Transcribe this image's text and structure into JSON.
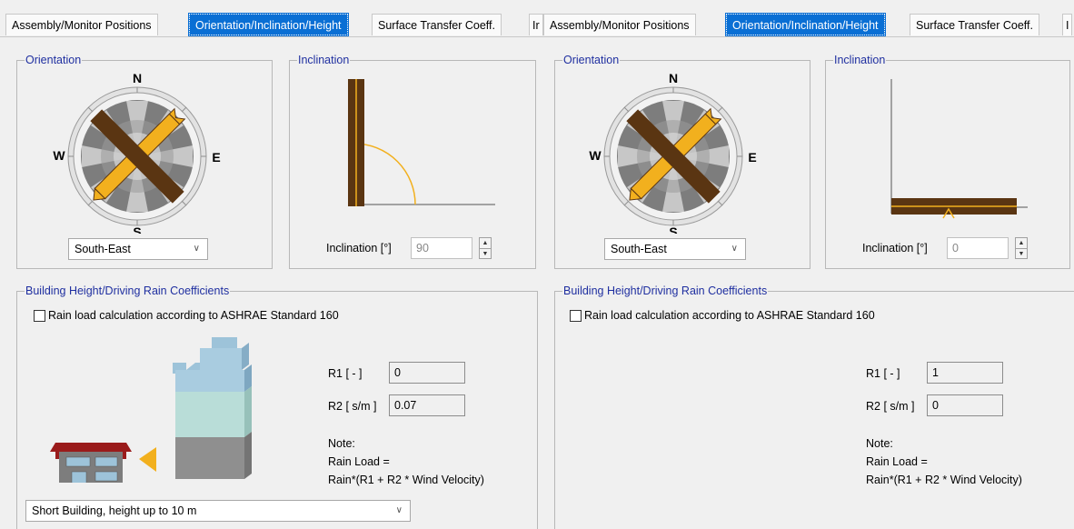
{
  "left": {
    "tabs": [
      "Assembly/Monitor Positions",
      "Orientation/Inclination/Height",
      "Surface Transfer Coeff.",
      "Ir"
    ],
    "active_tab": 1,
    "orientation": {
      "legend": "Orientation",
      "compass": {
        "n": "N",
        "s": "S",
        "e": "E",
        "w": "W"
      },
      "selected": "South-East"
    },
    "inclination": {
      "legend": "Inclination",
      "label": "Inclination [°]",
      "value": "90"
    },
    "building": {
      "legend": "Building Height/Driving Rain Coefficients",
      "checkbox_label": "Rain load calculation according to ASHRAE Standard 160",
      "r1_label": "R1 [ - ]",
      "r1_value": "0",
      "r2_label": "R2 [ s/m ]",
      "r2_value": "0.07",
      "note": [
        "Note:",
        "Rain Load =",
        "Rain*(R1 + R2 * Wind Velocity)"
      ],
      "height_option": "Short Building, height up to 10 m"
    }
  },
  "right": {
    "tabs": [
      "Assembly/Monitor Positions",
      "Orientation/Inclination/Height",
      "Surface Transfer Coeff.",
      "I"
    ],
    "active_tab": 1,
    "orientation": {
      "legend": "Orientation",
      "compass": {
        "n": "N",
        "s": "S",
        "e": "E",
        "w": "W"
      },
      "selected": "South-East"
    },
    "inclination": {
      "legend": "Inclination",
      "label": "Inclination [°]",
      "value": "0"
    },
    "building": {
      "legend": "Building Height/Driving Rain Coefficients",
      "checkbox_label": "Rain load calculation according to ASHRAE Standard 160",
      "r1_label": "R1 [ - ]",
      "r1_value": "1",
      "r2_label": "R2 [ s/m ]",
      "r2_value": "0",
      "note": [
        "Note:",
        "Rain Load =",
        "Rain*(R1 + R2 * Wind Velocity)"
      ]
    }
  },
  "colors": {
    "accent": "#0a6fd4",
    "legend": "#1f2fa0",
    "wall": "#5a3512",
    "wall_stripe": "#f2b01e",
    "arc": "#f2b01e"
  }
}
